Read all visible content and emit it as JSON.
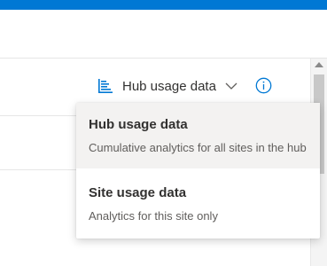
{
  "colors": {
    "accent": "#0078d4",
    "menu_hover": "#f3f2f1",
    "text_primary": "#323130",
    "text_secondary": "#605e5c"
  },
  "usage_selector": {
    "icon": "bar-chart-icon",
    "selected_label": "Hub usage data",
    "chevron_icon": "chevron-down-icon",
    "info_icon": "info-icon"
  },
  "menu": {
    "items": [
      {
        "title": "Hub usage data",
        "description": "Cumulative analytics for all sites in the hub",
        "highlighted": true
      },
      {
        "title": "Site usage data",
        "description": "Analytics for this site only",
        "highlighted": false
      }
    ]
  }
}
